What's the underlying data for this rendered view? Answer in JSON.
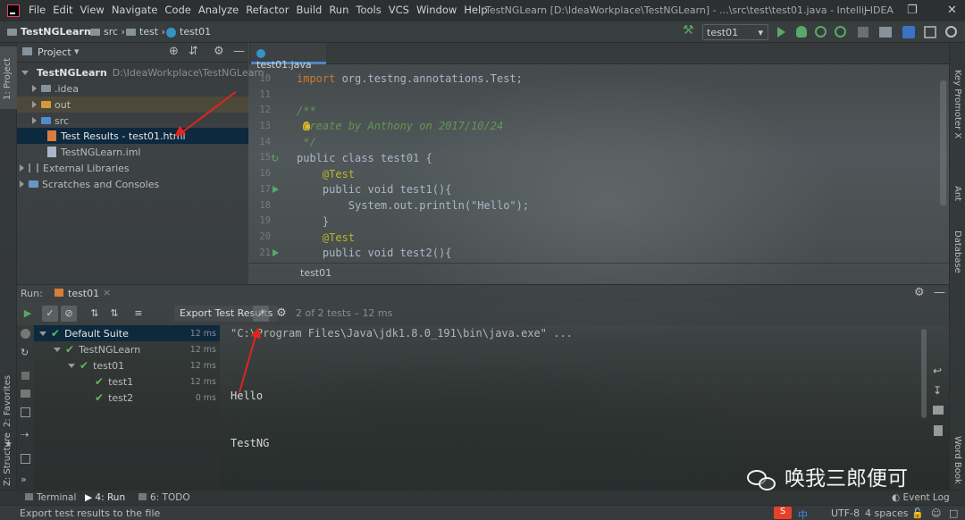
{
  "menu": [
    "File",
    "Edit",
    "View",
    "Navigate",
    "Code",
    "Analyze",
    "Refactor",
    "Build",
    "Run",
    "Tools",
    "VCS",
    "Window",
    "Help"
  ],
  "window_title": "TestNGLearn [D:\\IdeaWorkplace\\TestNGLearn] - ...\\src\\test\\test01.java - IntelliJ IDEA",
  "breadcrumbs": [
    "TestNGLearn",
    "src",
    "test",
    "test01"
  ],
  "run_config": "test01",
  "left_strip": {
    "project": "1: Project",
    "favorites": "2: Favorites",
    "structure": "Z: Structure"
  },
  "right_strip": {
    "key_promoter": "Key Promoter X",
    "ant": "Ant",
    "database": "Database",
    "word_book": "Word Book"
  },
  "project": {
    "header": "Project",
    "tree": [
      {
        "label": "TestNGLearn",
        "path": "D:\\IdeaWorkplace\\TestNGLearn"
      },
      {
        "label": ".idea"
      },
      {
        "label": "out"
      },
      {
        "label": "src"
      },
      {
        "label": "Test Results - test01.html"
      },
      {
        "label": "TestNGLearn.iml"
      },
      {
        "label": "External Libraries"
      },
      {
        "label": "Scratches and Consoles"
      }
    ]
  },
  "editor": {
    "tab": "test01.java",
    "line_numbers": [
      "10",
      "11",
      "12",
      "13",
      "14",
      "15",
      "16",
      "17",
      "18",
      "19",
      "20",
      "21"
    ],
    "lines": [
      "import org.testng.annotations.Test;",
      "",
      "/**",
      " create by Anthony on 2017/10/24",
      " */",
      "public class test01 {",
      "    @Test",
      "    public void test1(){",
      "        System.out.println(\"Hello\");",
      "    }",
      "    @Test",
      "    public void test2(){"
    ],
    "breadcrumb": "test01"
  },
  "run": {
    "label": "Run:",
    "tab": "test01",
    "export_button": "Export Test Results",
    "summary": "2 of 2 tests – 12 ms",
    "results": [
      {
        "name": "Default Suite",
        "duration": "12 ms"
      },
      {
        "name": "TestNGLearn",
        "duration": "12 ms"
      },
      {
        "name": "test01",
        "duration": "12 ms"
      },
      {
        "name": "test1",
        "duration": "12 ms"
      },
      {
        "name": "test2",
        "duration": "0 ms"
      }
    ],
    "console": [
      "\"C:\\Program Files\\Java\\jdk1.8.0_191\\bin\\java.exe\" ...",
      "Hello",
      "TestNG"
    ]
  },
  "bottom_tabs": {
    "terminal": "Terminal",
    "run": "4: Run",
    "todo": "6: TODO",
    "event_log": "Event Log"
  },
  "status": {
    "message": "Export test results to the file",
    "encoding": "UTF-8",
    "indent": "4 spaces",
    "ime": "中"
  },
  "watermark": "唤我三郎便可",
  "colors": {
    "annotation_red": "#e0251f",
    "selection": "#0d293e",
    "pass_green": "#5fb85f"
  }
}
